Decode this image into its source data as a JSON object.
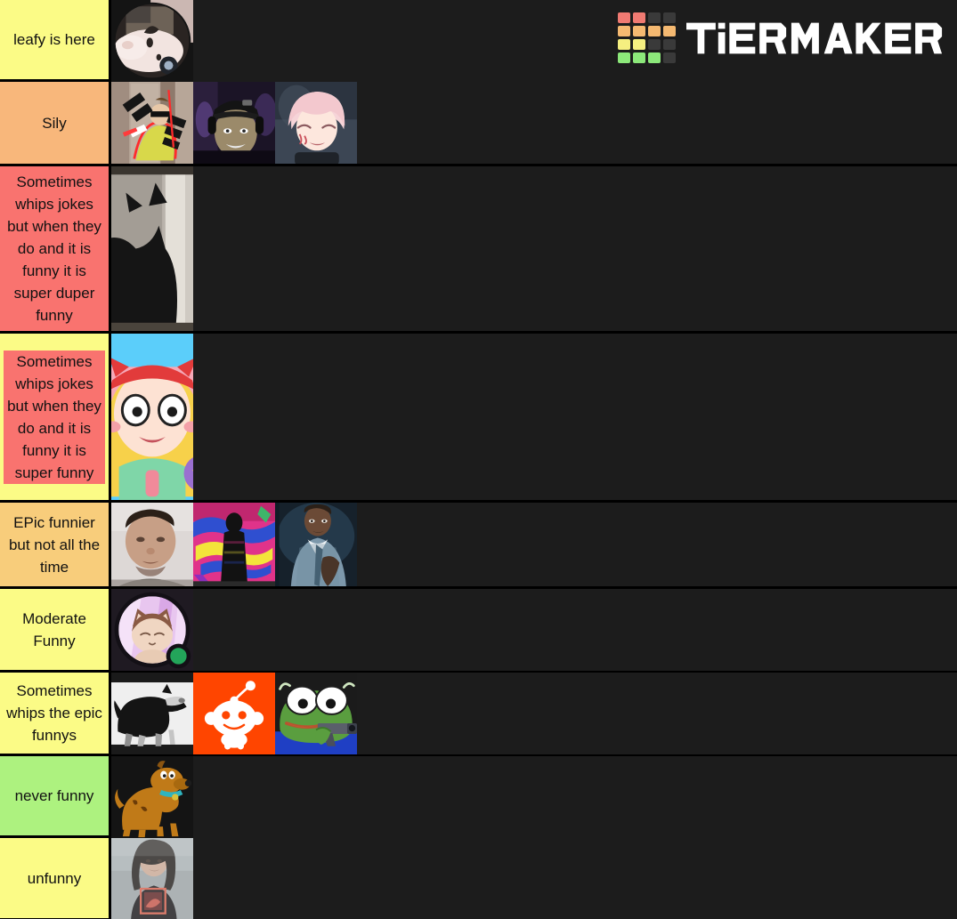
{
  "brand": {
    "name": "TIERMAKER",
    "logo_icon": "tiermaker-grid-logo",
    "grid_colors": [
      [
        "#f07a72",
        "#f07a72",
        "#3a3a3a",
        "#3a3a3a"
      ],
      [
        "#f5b971",
        "#f5b971",
        "#f5b971",
        "#f5b971"
      ],
      [
        "#f5ef80",
        "#f5ef80",
        "#3a3a3a",
        "#3a3a3a"
      ],
      [
        "#8ce87a",
        "#8ce87a",
        "#8ce87a",
        "#3a3a3a"
      ]
    ],
    "wordmark_color": "#ffffff"
  },
  "background_color": "#000000",
  "row_background_color": "#1c1c1c",
  "tiers": [
    {
      "label": "leafy is here",
      "color": "#fbfb86",
      "highlight_color": null,
      "height": 92,
      "items": [
        {
          "name": "white-dog-avatar",
          "alt": "White pitbull dog in circular avatar"
        }
      ]
    },
    {
      "label": "Sily",
      "color": "#f8b77b",
      "highlight_color": null,
      "height": 95,
      "items": [
        {
          "name": "sunglasses-sticker-meme",
          "alt": "Person with sunglasses and stickers meme"
        },
        {
          "name": "streamer-cap-headphones",
          "alt": "Streamer wearing cap and headphones"
        },
        {
          "name": "pink-hair-anime-character",
          "alt": "Anime character with pink hair smiling"
        }
      ]
    },
    {
      "label": "Sometimes whips jokes but when they do and it is funny it is super duper funny",
      "color": "#f9736f",
      "highlight_color": null,
      "height": 188,
      "items": [
        {
          "name": "black-cat-photo",
          "alt": "Black cat silhouette by a door"
        }
      ]
    },
    {
      "label": "Sometimes whips jokes but when they do and it is funny it is super funny",
      "color": "#fbfb86",
      "highlight_color": "#f9736f",
      "height": 190,
      "items": [
        {
          "name": "star-butterfly-trans-flag",
          "alt": "Star Butterfly on trans pride flag"
        }
      ]
    },
    {
      "label": "EPic funnier but not all the time",
      "color": "#f8cd7b",
      "highlight_color": null,
      "height": 97,
      "items": [
        {
          "name": "blurry-selfie-photo",
          "alt": "Blurry selfie of a person"
        },
        {
          "name": "graffiti-silhouette-photo",
          "alt": "Black silhouette against graffiti wall"
        },
        {
          "name": "man-in-suit-photo",
          "alt": "Man adjusting tie in blue suit"
        }
      ]
    },
    {
      "label": "Moderate Funny",
      "color": "#fbfb86",
      "highlight_color": null,
      "height": 94,
      "items": [
        {
          "name": "discord-cat-avatar",
          "alt": "Discord cat avatar with online status"
        }
      ]
    },
    {
      "label": "Sometimes whips the epic funnys",
      "color": "#fbfb86",
      "highlight_color": null,
      "height": 94,
      "items": [
        {
          "name": "black-white-dog-photo",
          "alt": "Black and white dog walking"
        },
        {
          "name": "reddit-snoo-logo",
          "alt": "Reddit Snoo mascot on orange"
        },
        {
          "name": "pepe-with-gun-meme",
          "alt": "Pepe the frog holding a gun"
        }
      ]
    },
    {
      "label": "never funny",
      "color": "#adf27f",
      "highlight_color": null,
      "height": 92,
      "items": [
        {
          "name": "scooby-doo-character",
          "alt": "Scooby-Doo cartoon dog"
        }
      ]
    },
    {
      "label": "unfunny",
      "color": "#fbfb86",
      "highlight_color": null,
      "height": 93,
      "items": [
        {
          "name": "person-graphic-tshirt-photo",
          "alt": "Person with long hair in black graphic t-shirt"
        }
      ]
    }
  ]
}
